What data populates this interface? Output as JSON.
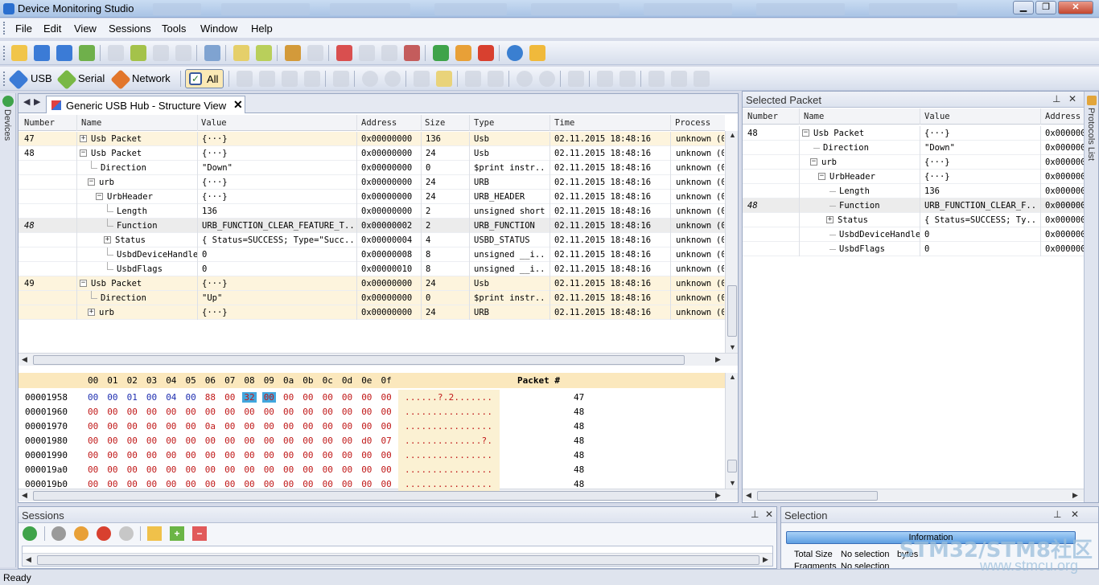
{
  "app": {
    "title": "Device Monitoring Studio"
  },
  "menu": [
    "File",
    "Edit",
    "View",
    "Sessions",
    "Tools",
    "Window",
    "Help"
  ],
  "toolbar2": {
    "usb": "USB",
    "serial": "Serial",
    "network": "Network",
    "all": "All"
  },
  "left_strip": {
    "label": "Devices"
  },
  "right_strip": {
    "label": "Protocols List"
  },
  "document": {
    "tab": "Generic USB Hub - Structure View"
  },
  "structure": {
    "headers": [
      "Number",
      "Name",
      "Value",
      "Address",
      "Size",
      "Type",
      "Time",
      "Process"
    ],
    "rows": [
      {
        "number": "47",
        "name": "Usb Packet",
        "value": "{···}",
        "address": "0x00000000",
        "size": "136",
        "type": "Usb",
        "time": "02.11.2015 18:48:16",
        "process": "unknown",
        "pid": "(0"
      },
      {
        "number": "48",
        "name": "Usb Packet",
        "value": "{···}",
        "address": "0x00000000",
        "size": "24",
        "type": "Usb",
        "time": "02.11.2015 18:48:16",
        "process": "unknown",
        "pid": "(0"
      },
      {
        "number": "",
        "name": "Direction",
        "value": "\"Down\"",
        "address": "0x00000000",
        "size": "0",
        "type": "$print instr...",
        "time": "02.11.2015 18:48:16",
        "process": "unknown",
        "pid": "(0"
      },
      {
        "number": "",
        "name": "urb",
        "value": "{···}",
        "address": "0x00000000",
        "size": "24",
        "type": "URB",
        "time": "02.11.2015 18:48:16",
        "process": "unknown",
        "pid": "(0"
      },
      {
        "number": "",
        "name": "UrbHeader",
        "value": "{···}",
        "address": "0x00000000",
        "size": "24",
        "type": "URB_HEADER",
        "time": "02.11.2015 18:48:16",
        "process": "unknown",
        "pid": "(0"
      },
      {
        "number": "",
        "name": "Length",
        "value": "136",
        "address": "0x00000000",
        "size": "2",
        "type": "unsigned short",
        "time": "02.11.2015 18:48:16",
        "process": "unknown",
        "pid": "(0"
      },
      {
        "number": "48",
        "name": "Function",
        "value": "URB_FUNCTION_CLEAR_FEATURE_T...",
        "address": "0x00000002",
        "size": "2",
        "type": "URB_FUNCTION",
        "time": "02.11.2015 18:48:16",
        "process": "unknown",
        "pid": "(0"
      },
      {
        "number": "",
        "name": "Status",
        "value": "{ Status=SUCCESS; Type=\"Succ...",
        "address": "0x00000004",
        "size": "4",
        "type": "USBD_STATUS",
        "time": "02.11.2015 18:48:16",
        "process": "unknown",
        "pid": "(0"
      },
      {
        "number": "",
        "name": "UsbdDeviceHandle",
        "value": "0",
        "address": "0x00000008",
        "size": "8",
        "type": "unsigned __i...",
        "time": "02.11.2015 18:48:16",
        "process": "unknown",
        "pid": "(0"
      },
      {
        "number": "",
        "name": "UsbdFlags",
        "value": "0",
        "address": "0x00000010",
        "size": "8",
        "type": "unsigned __i...",
        "time": "02.11.2015 18:48:16",
        "process": "unknown",
        "pid": "(0"
      },
      {
        "number": "49",
        "name": "Usb Packet",
        "value": "{···}",
        "address": "0x00000000",
        "size": "24",
        "type": "Usb",
        "time": "02.11.2015 18:48:16",
        "process": "unknown",
        "pid": "(0"
      },
      {
        "number": "",
        "name": "Direction",
        "value": "\"Up\"",
        "address": "0x00000000",
        "size": "0",
        "type": "$print instr...",
        "time": "02.11.2015 18:48:16",
        "process": "unknown",
        "pid": "(0"
      },
      {
        "number": "",
        "name": "urb",
        "value": "{···}",
        "address": "0x00000000",
        "size": "24",
        "type": "URB",
        "time": "02.11.2015 18:48:16",
        "process": "unknown",
        "pid": "(0"
      }
    ]
  },
  "hex": {
    "header_bytes": [
      "00",
      "01",
      "02",
      "03",
      "04",
      "05",
      "06",
      "07",
      "08",
      "09",
      "0a",
      "0b",
      "0c",
      "0d",
      "0e",
      "0f"
    ],
    "packet_header": "Packet #",
    "rows": [
      {
        "offset": "00001958",
        "bytes": [
          "00",
          "00",
          "01",
          "00",
          "04",
          "00",
          "88",
          "00",
          "32",
          "00",
          "00",
          "00",
          "00",
          "00",
          "00",
          "00"
        ],
        "ascii": "......?.2.......",
        "packet": "47"
      },
      {
        "offset": "00001960",
        "bytes": [
          "00",
          "00",
          "00",
          "00",
          "00",
          "00",
          "00",
          "00",
          "00",
          "00",
          "00",
          "00",
          "00",
          "00",
          "00",
          "00"
        ],
        "ascii": "................",
        "packet": "48"
      },
      {
        "offset": "00001970",
        "bytes": [
          "00",
          "00",
          "00",
          "00",
          "00",
          "00",
          "0a",
          "00",
          "00",
          "00",
          "00",
          "00",
          "00",
          "00",
          "00",
          "00"
        ],
        "ascii": "................",
        "packet": "48"
      },
      {
        "offset": "00001980",
        "bytes": [
          "00",
          "00",
          "00",
          "00",
          "00",
          "00",
          "00",
          "00",
          "00",
          "00",
          "00",
          "00",
          "00",
          "00",
          "d0",
          "07"
        ],
        "ascii": "..............?.",
        "packet": "48"
      },
      {
        "offset": "00001990",
        "bytes": [
          "00",
          "00",
          "00",
          "00",
          "00",
          "00",
          "00",
          "00",
          "00",
          "00",
          "00",
          "00",
          "00",
          "00",
          "00",
          "00"
        ],
        "ascii": "................",
        "packet": "48"
      },
      {
        "offset": "000019a0",
        "bytes": [
          "00",
          "00",
          "00",
          "00",
          "00",
          "00",
          "00",
          "00",
          "00",
          "00",
          "00",
          "00",
          "00",
          "00",
          "00",
          "00"
        ],
        "ascii": "................",
        "packet": "48"
      },
      {
        "offset": "000019b0",
        "bytes": [
          "00",
          "00",
          "00",
          "00",
          "00",
          "00",
          "00",
          "00",
          "00",
          "00",
          "00",
          "00",
          "00",
          "00",
          "00",
          "00"
        ],
        "ascii": "................",
        "packet": "48"
      }
    ]
  },
  "selected_packet": {
    "title": "Selected Packet",
    "headers": [
      "Number",
      "Name",
      "Value",
      "Address"
    ],
    "rows": [
      {
        "number": "48",
        "name": "Usb Packet",
        "value": "{···}",
        "address": "0x000000"
      },
      {
        "number": "",
        "name": "Direction",
        "value": "\"Down\"",
        "address": "0x000000"
      },
      {
        "number": "",
        "name": "urb",
        "value": "{···}",
        "address": "0x000000"
      },
      {
        "number": "",
        "name": "UrbHeader",
        "value": "{···}",
        "address": "0x000000"
      },
      {
        "number": "",
        "name": "Length",
        "value": "136",
        "address": "0x000000"
      },
      {
        "number": "48",
        "name": "Function",
        "value": "URB_FUNCTION_CLEAR_F...",
        "address": "0x000000"
      },
      {
        "number": "",
        "name": "Status",
        "value": "{ Status=SUCCESS; Ty...",
        "address": "0x000000"
      },
      {
        "number": "",
        "name": "UsbdDeviceHandle",
        "value": "0",
        "address": "0x000000"
      },
      {
        "number": "",
        "name": "UsbdFlags",
        "value": "0",
        "address": "0x000000"
      }
    ]
  },
  "sessions_panel": {
    "title": "Sessions"
  },
  "selection_panel": {
    "title": "Selection",
    "tab": "Information",
    "total_size_label": "Total Size",
    "total_size_value": "No selection",
    "total_size_unit": "bytes",
    "fragments_label": "Fragments",
    "fragments_value": "No selection"
  },
  "status": "Ready",
  "watermark": {
    "line1": "STM32/STM8社区",
    "line2": "www.stmcu.org"
  }
}
